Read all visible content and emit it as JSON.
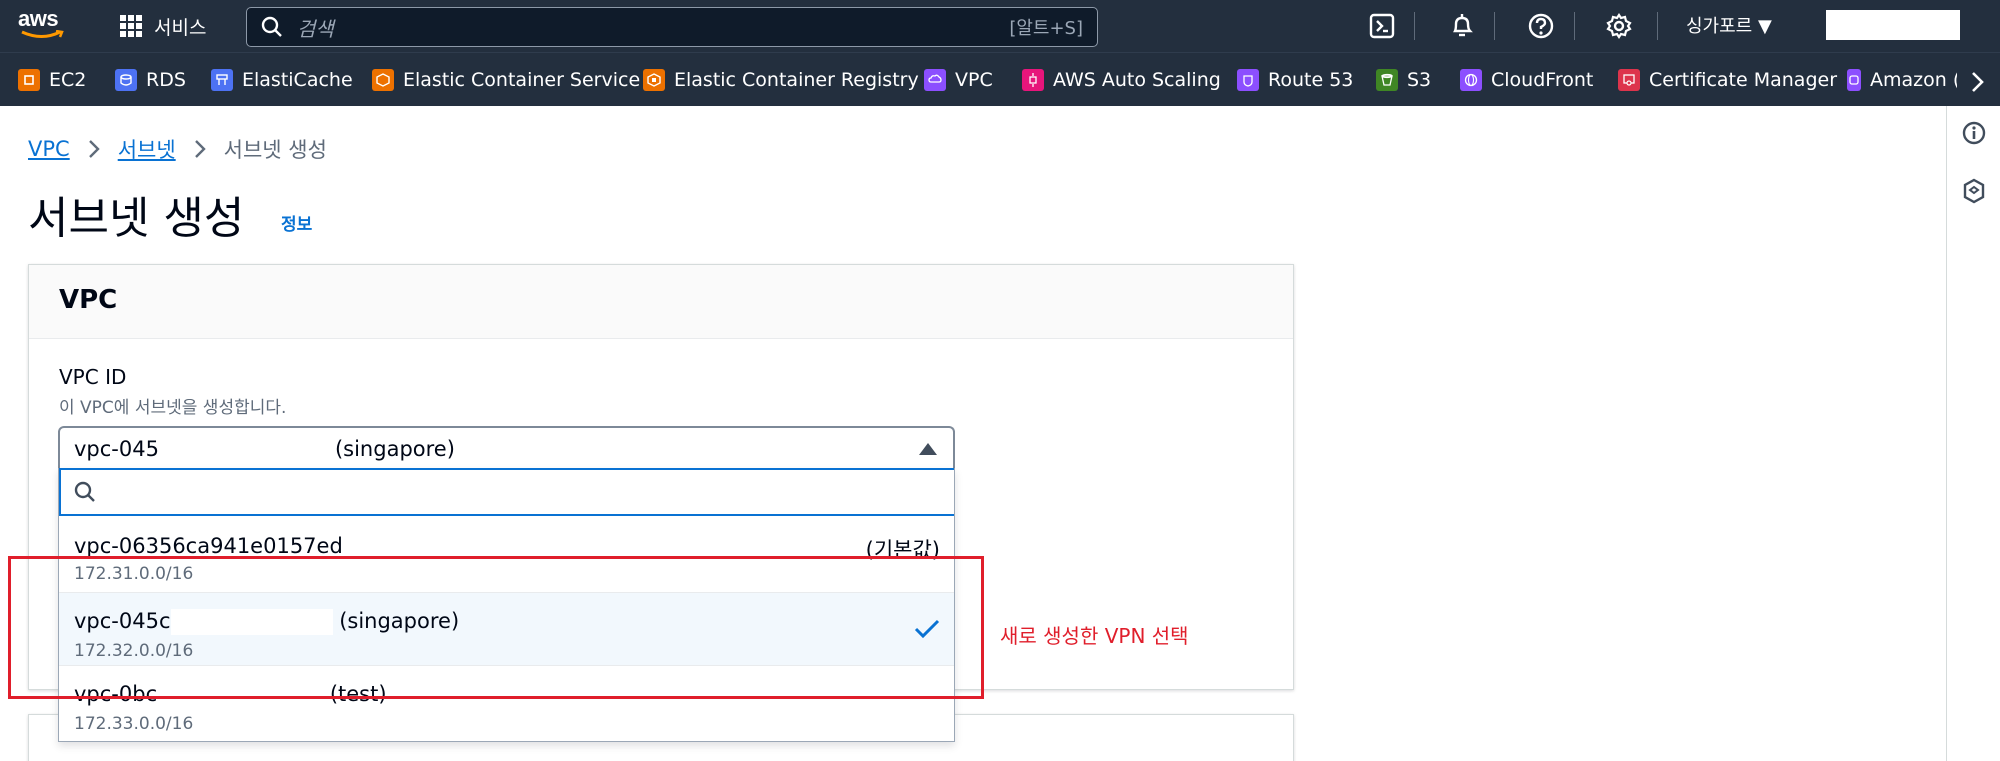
{
  "topnav": {
    "logo_text": "aws",
    "services_label": "서비스",
    "search_placeholder": "검색",
    "search_shortcut": "[알트+S]",
    "region_label": "싱가포르 ▼"
  },
  "favorites": [
    {
      "label": "EC2",
      "color": "#ed7100"
    },
    {
      "label": "RDS",
      "color": "#4d72f3"
    },
    {
      "label": "ElastiCache",
      "color": "#4d72f3"
    },
    {
      "label": "Elastic Container Service",
      "color": "#ed7100"
    },
    {
      "label": "Elastic Container Registry",
      "color": "#ed7100"
    },
    {
      "label": "VPC",
      "color": "#8c4fff"
    },
    {
      "label": "AWS Auto Scaling",
      "color": "#e7157b"
    },
    {
      "label": "Route 53",
      "color": "#8c4fff"
    },
    {
      "label": "S3",
      "color": "#3f8624"
    },
    {
      "label": "CloudFront",
      "color": "#8c4fff"
    },
    {
      "label": "Certificate Manager",
      "color": "#dd344c"
    },
    {
      "label": "Amazon (",
      "color": "#8c4fff"
    }
  ],
  "breadcrumb": {
    "items": [
      "VPC",
      "서브넷"
    ],
    "current": "서브넷 생성"
  },
  "page": {
    "title": "서브넷 생성",
    "info_link": "정보"
  },
  "vpc_section": {
    "header": "VPC",
    "field_label": "VPC ID",
    "field_description": "이 VPC에 서브넷을 생성합니다.",
    "selected_value_prefix": "vpc-045",
    "selected_value_suffix": "(singapore)"
  },
  "dropdown": {
    "options": [
      {
        "id": "vpc-06356ca941e0157ed",
        "cidr": "172.31.0.0/16",
        "tag": "(기본값)"
      },
      {
        "id_prefix": "vpc-045c",
        "id_suffix": "(singapore)",
        "cidr": "172.32.0.0/16"
      },
      {
        "id_prefix": "vpc-0bc",
        "id_suffix": "(test)",
        "cidr": "172.33.0.0/16"
      }
    ]
  },
  "annotation": {
    "text": "새로 생성한 VPN 선택",
    "color": "#e01e2b"
  },
  "colors": {
    "nav_bg": "#232f3e",
    "link": "#0972d3",
    "focus": "#0972d3"
  }
}
